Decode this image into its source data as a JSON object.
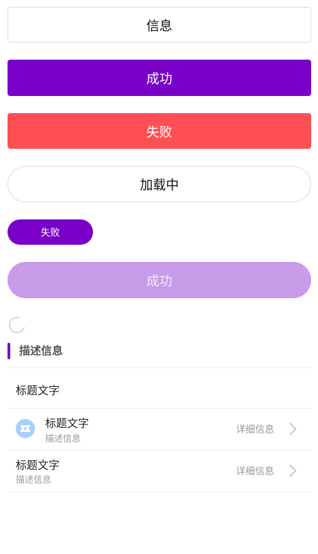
{
  "buttons": {
    "info": "信息",
    "success": "成功",
    "fail": "失败",
    "loading": "加载中",
    "small_fail": "失败",
    "disabled_success": "成功"
  },
  "section": {
    "title": "描述信息"
  },
  "cells": [
    {
      "title": "标题文字"
    },
    {
      "title": "标题文字",
      "desc": "描述信息",
      "detail": "详细信息",
      "icon": "ticket-icon"
    },
    {
      "title": "标题文字",
      "desc": "描述信息",
      "detail": "详细信息"
    }
  ],
  "colors": {
    "primary": "#7a00c8",
    "danger": "#ff4f54",
    "disabled": "#c89be9",
    "icon_bg": "#a7d0fb"
  }
}
